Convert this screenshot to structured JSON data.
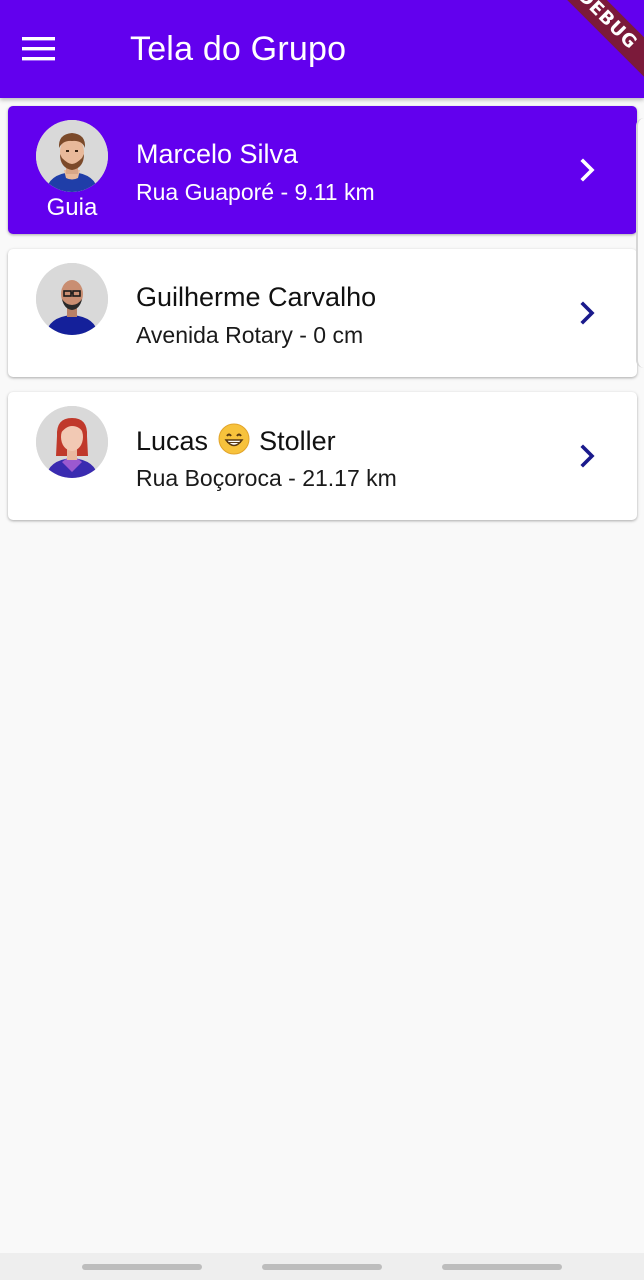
{
  "appbar": {
    "title": "Tela do Grupo",
    "menu_icon": "hamburger-menu-icon",
    "debug_banner": "DEBUG",
    "background": "#6200ee"
  },
  "members": [
    {
      "name": "Marcelo Silva",
      "subtitle": "Rua Guaporé - 9.11 km",
      "badge": "Guia",
      "avatar": "bearded-man-avatar-icon",
      "highlighted": true
    },
    {
      "name": "Guilherme Carvalho",
      "subtitle": "Avenida Rotary - 0 cm",
      "avatar": "bald-man-glasses-avatar-icon",
      "highlighted": false
    },
    {
      "name_before_emoji": "Lucas",
      "emoji": "grinning-face-emoji",
      "name_after_emoji": "Stoller",
      "subtitle": "Rua Boçoroca - 21.17 km",
      "avatar": "red-hair-woman-avatar-icon",
      "highlighted": false
    }
  ],
  "icons": {
    "chevron": "chevron-right-icon"
  },
  "colors": {
    "accent": "#6200ee",
    "chevron_dark": "#1a1a8c",
    "card_background": "#ffffff",
    "page_background": "#f9f9f9"
  }
}
